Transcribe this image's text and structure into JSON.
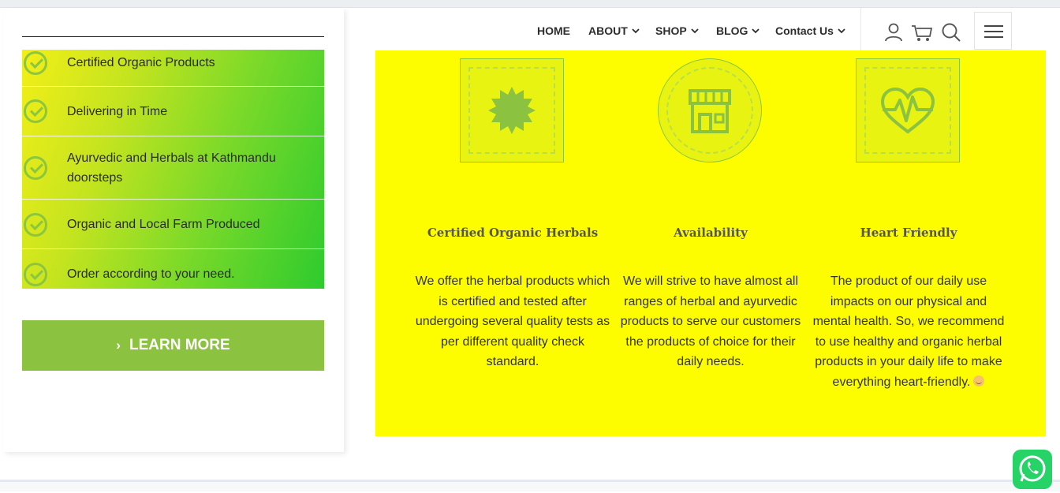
{
  "nav": {
    "items": [
      {
        "label": "HOME",
        "has_caret": false
      },
      {
        "label": "ABOUT",
        "has_caret": true
      },
      {
        "label": "SHOP",
        "has_caret": true
      },
      {
        "label": "BLOG",
        "has_caret": true
      },
      {
        "label": "Contact Us",
        "has_caret": true
      }
    ],
    "icons": [
      "user-icon",
      "cart-icon",
      "search-icon",
      "hamburger-menu-icon"
    ]
  },
  "features": {
    "items": [
      "Certified Organic Products",
      "Delivering in Time",
      "Ayurvedic and Herbals at Kathmandu doorsteps",
      "Organic and Local Farm Produced",
      "Order according to your need."
    ]
  },
  "cta": {
    "label": "LEARN MORE"
  },
  "cards": [
    {
      "icon": "badge-icon",
      "title": "Certified Organic Herbals",
      "text": "We offer the herbal products which is certified and tested after undergoing several quality tests as per different quality check standard."
    },
    {
      "icon": "store-icon",
      "title": "Availability",
      "text": "We will strive to have almost all ranges of herbal and ayurvedic products  to serve our customers the products of choice for their daily needs."
    },
    {
      "icon": "heart-pulse-icon",
      "title": "Heart Friendly",
      "text": "The product of our daily use impacts on our physical and mental health. So, we recommend to use healthy and organic herbal products in your daily life to make  everything heart-friendly."
    }
  ],
  "floating": {
    "icon": "whatsapp-icon"
  },
  "colors": {
    "accent_green": "#8bc23f",
    "section_yellow": "#fdfd00",
    "gradient_start": "#f3ef17",
    "gradient_end": "#2ecb2e"
  }
}
